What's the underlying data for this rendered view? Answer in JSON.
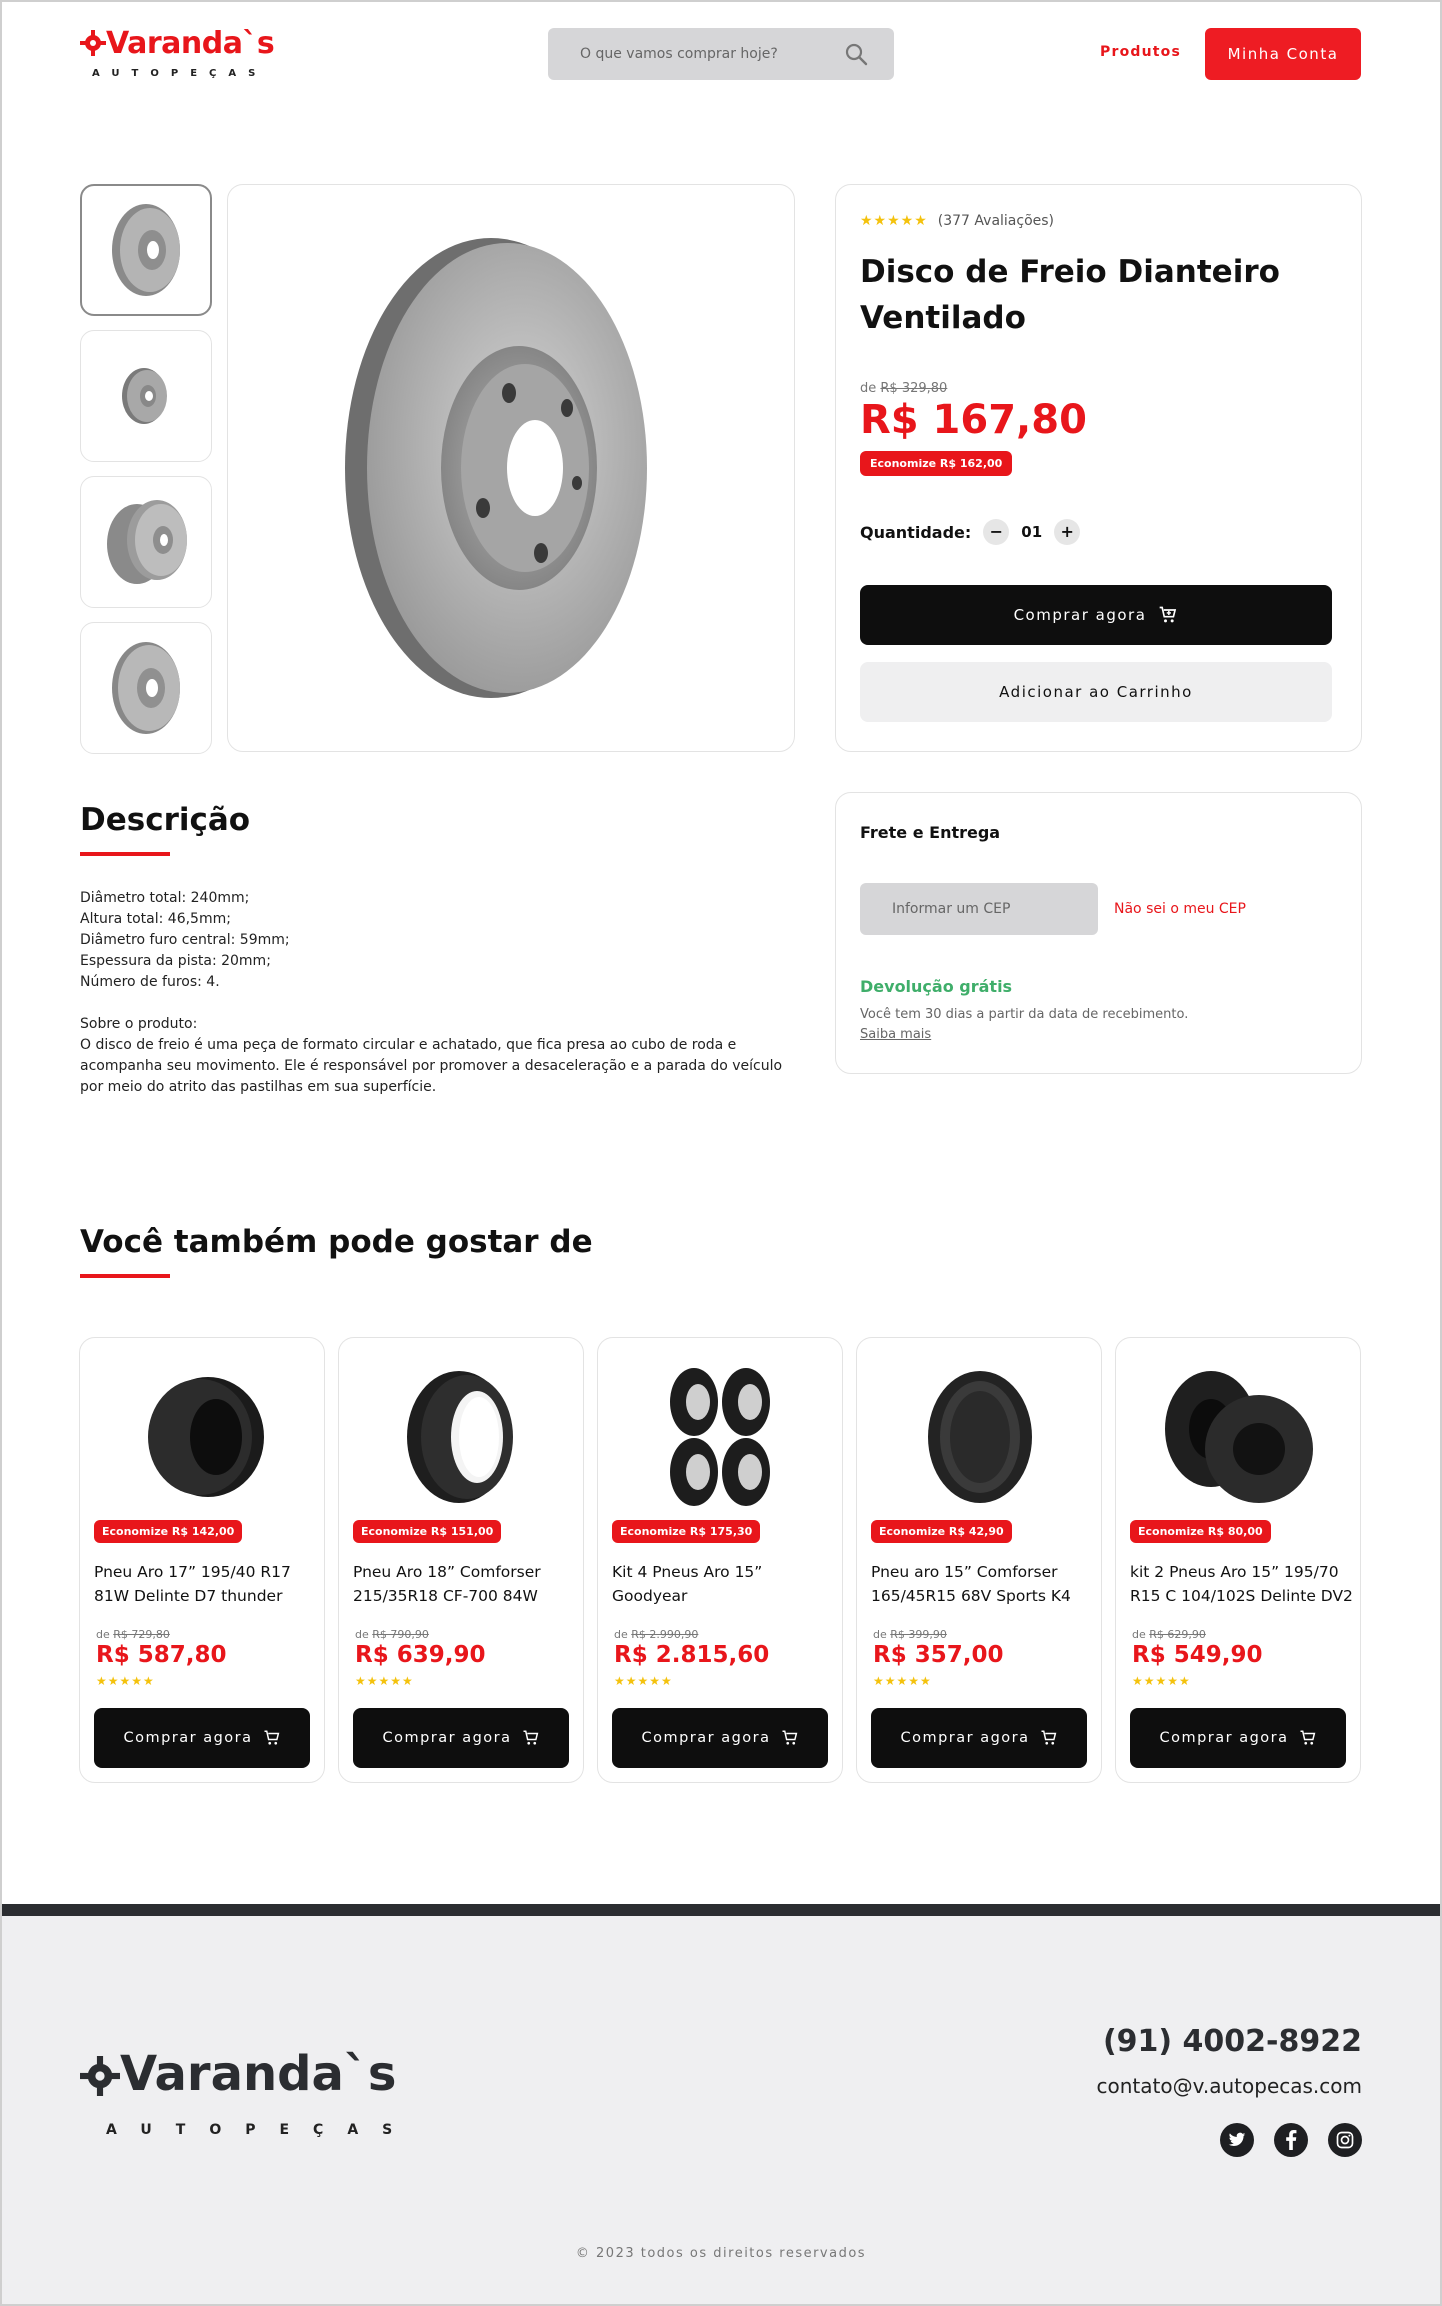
{
  "header": {
    "logo_text": "Varanda`s",
    "logo_sub": "AUTOPEÇAS",
    "search_placeholder": "O que vamos comprar hoje?",
    "nav_products": "Produtos",
    "account_button": "Minha Conta"
  },
  "product": {
    "stars": "★★★★★",
    "rating_value": 4.5,
    "reviews": "(377 Avaliações)",
    "title": "Disco de Freio Dianteiro Ventilado",
    "old_price_prefix": "de",
    "old_price": "R$ 329,80",
    "price": "R$ 167,80",
    "saving": "Economize R$ 162,00",
    "quantity_label": "Quantidade:",
    "quantity_value": "01",
    "buy_label": "Comprar agora",
    "cart_label": "Adicionar ao Carrinho"
  },
  "description": {
    "title": "Descrição",
    "specs": [
      "Diâmetro total: 240mm;",
      "Altura total: 46,5mm;",
      "Diâmetro furo central: 59mm;",
      "Espessura da pista: 20mm;",
      "Número de furos: 4."
    ],
    "about_label": "Sobre o produto:",
    "about_text": "O disco de freio é uma peça de formato circular e achatado, que fica presa ao cubo de roda e acompanha seu movimento. Ele é responsável por promover a desaceleração e a parada do veículo por meio do atrito das pastilhas em sua superfície."
  },
  "shipping": {
    "title": "Frete e Entrega",
    "cep_placeholder": "Informar um CEP",
    "unknown_cep": "Não sei o meu CEP",
    "return_title": "Devolução grátis",
    "return_text": "Você tem 30 dias a partir da data de recebimento.",
    "more_link": "Saiba mais"
  },
  "recommendations": {
    "title": "Você também pode gostar de",
    "items": [
      {
        "saving": "Economize R$ 142,00",
        "name": "Pneu Aro 17” 195/40 R17 81W Delinte D7 thunder",
        "old_prefix": "de",
        "old": "R$ 729,80",
        "price": "R$ 587,80",
        "stars": "★★★★★",
        "rating": 4.5,
        "buy": "Comprar agora"
      },
      {
        "saving": "Economize R$ 151,00",
        "name": "Pneu Aro 18” Comforser 215/35R18 CF-700 84W",
        "old_prefix": "de",
        "old": "R$ 790,90",
        "price": "R$ 639,90",
        "stars": "★★★★★",
        "rating": 4.5,
        "buy": "Comprar agora"
      },
      {
        "saving": "Economize R$ 175,30",
        "name": "Kit 4 Pneus Aro 15” Goodyear",
        "old_prefix": "de",
        "old": "R$ 2.990,90",
        "price": "R$ 2.815,60",
        "stars": "★★★★★",
        "rating": 4.5,
        "buy": "Comprar agora"
      },
      {
        "saving": "Economize R$ 42,90",
        "name": "Pneu aro 15” Comforser 165/45R15 68V Sports K4",
        "old_prefix": "de",
        "old": "R$ 399,90",
        "price": "R$ 357,00",
        "stars": "★★★★★",
        "rating": 4.5,
        "buy": "Comprar agora"
      },
      {
        "saving": "Economize R$ 80,00",
        "name": "kit 2 Pneus Aro 15” 195/70 R15 C 104/102S Delinte DV2",
        "old_prefix": "de",
        "old": "R$ 629,90",
        "price": "R$ 549,90",
        "stars": "★★★★★",
        "rating": 4.5,
        "buy": "Comprar agora"
      }
    ]
  },
  "footer": {
    "logo_text": "Varanda`s",
    "logo_sub": "AUTOPEÇAS",
    "phone": "(91) 4002-8922",
    "email": "contato@v.autopecas.com",
    "copyright": "© 2023 todos os direitos reservados",
    "socials": [
      "twitter-icon",
      "facebook-icon",
      "instagram-icon"
    ]
  },
  "colors": {
    "brand_red": "#e8161b",
    "dark": "#0e0e0e",
    "green": "#3fae6a",
    "star": "#f4c20d"
  }
}
